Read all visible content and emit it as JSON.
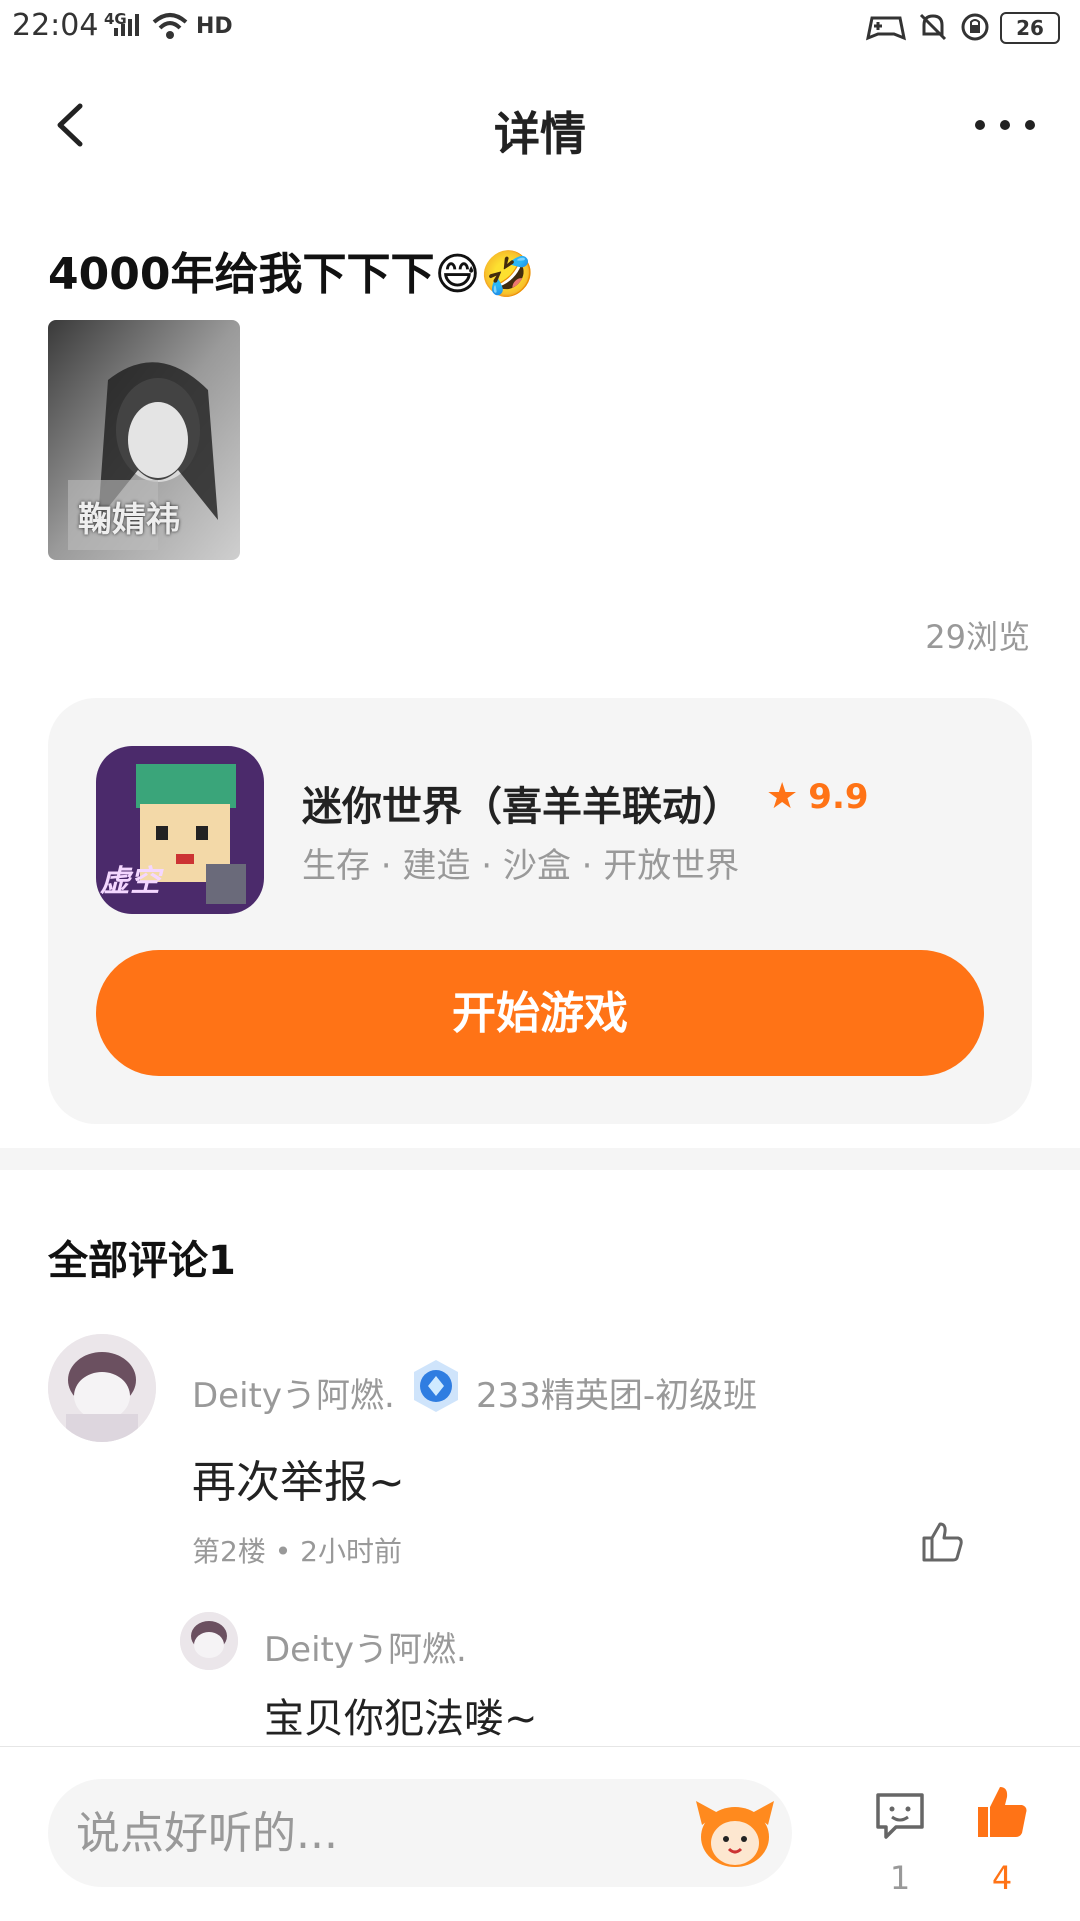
{
  "status_bar": {
    "time": "22:04",
    "network": "4G",
    "battery": "26",
    "hd": "HD"
  },
  "header": {
    "title": "详情"
  },
  "post": {
    "title": "4000年给我下下下😅🤣",
    "image_caption": "鞠婧祎",
    "views": "29浏览"
  },
  "game": {
    "name": "迷你世界（喜羊羊联动）",
    "rating": "9.9",
    "tags": "生存 · 建造 · 沙盒 · 开放世界",
    "icon_text": "虚空",
    "play_label": "开始游戏"
  },
  "comments": {
    "title": "全部评论1",
    "items": [
      {
        "user": "Deityう阿燃.",
        "badge_text": "233精英团-初级班",
        "text": "再次举报~",
        "meta": "第2楼 • 2小时前",
        "reply": {
          "user": "Deityう阿燃.",
          "text": "宝贝你犯法喽~"
        }
      }
    ]
  },
  "bottom_bar": {
    "input_placeholder": "说点好听的...",
    "comment_count": "1",
    "like_count": "4"
  },
  "colors": {
    "accent": "#ff7316",
    "muted": "#999999",
    "card_bg": "#f5f5f5"
  }
}
